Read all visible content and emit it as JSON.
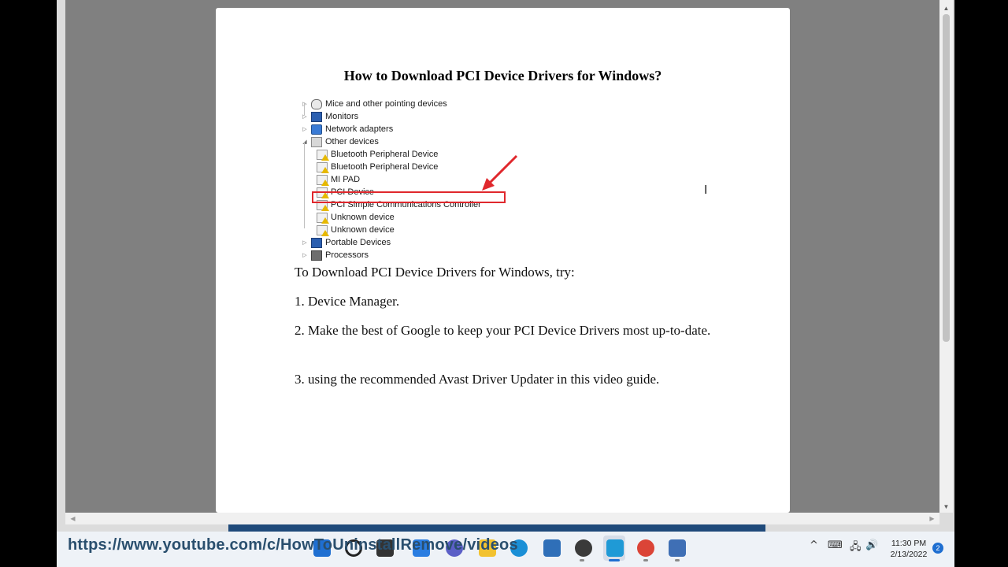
{
  "document": {
    "title": "How to Download PCI Device Drivers for Windows?",
    "device_tree": [
      {
        "label": "Mice and other pointing devices",
        "icon": "mouse-icon",
        "expander": "▷"
      },
      {
        "label": "Monitors",
        "icon": "monitor-icon",
        "expander": "▷"
      },
      {
        "label": "Network adapters",
        "icon": "network-adapter-icon",
        "expander": "▷"
      },
      {
        "label": "Other devices",
        "icon": "other-devices-icon",
        "expander": "◢"
      },
      {
        "label": "Bluetooth Peripheral Device",
        "icon": "warning-device-icon"
      },
      {
        "label": "Bluetooth Peripheral Device",
        "icon": "warning-device-icon"
      },
      {
        "label": "MI PAD",
        "icon": "warning-device-icon"
      },
      {
        "label": "PCI Device",
        "icon": "warning-device-icon"
      },
      {
        "label": "PCI Simple Communications Controller",
        "icon": "warning-device-icon",
        "highlighted": true
      },
      {
        "label": "Unknown device",
        "icon": "warning-device-icon"
      },
      {
        "label": "Unknown device",
        "icon": "warning-device-icon"
      },
      {
        "label": "Portable Devices",
        "icon": "portable-devices-icon",
        "expander": "▷"
      },
      {
        "label": "Processors",
        "icon": "processor-icon",
        "expander": "▷"
      }
    ],
    "paragraphs": [
      "To Download PCI Device Drivers for Windows, try:",
      "1. Device Manager.",
      "2. Make the best of Google to keep your PCI Device Drivers most up-to-date.",
      "3. using the recommended Avast Driver Updater in this video guide."
    ],
    "highlight_color": "#e0282d"
  },
  "scrollbars": {
    "up_arrow": "▲",
    "down_arrow": "▼",
    "left_arrow": "◀",
    "right_arrow": "▶"
  },
  "overlay": {
    "url": "https://www.youtube.com/c/HowToUninstallRemove/videos"
  },
  "taskbar": {
    "apps": [
      {
        "name": "start-icon",
        "color": "#1f6fd1"
      },
      {
        "name": "search-icon",
        "color": "#222222"
      },
      {
        "name": "task-view-icon",
        "color": "#333333"
      },
      {
        "name": "widgets-icon",
        "color": "#2a7de1"
      },
      {
        "name": "chat-icon",
        "color": "#5b5fc7"
      },
      {
        "name": "file-explorer-icon",
        "color": "#f2c230"
      },
      {
        "name": "edge-icon",
        "color": "#1a8fd6"
      },
      {
        "name": "store-icon",
        "color": "#2f6fb8"
      },
      {
        "name": "media-player-icon",
        "color": "#3a3a3a"
      },
      {
        "name": "reader-app-icon",
        "color": "#1f9ad6"
      },
      {
        "name": "chrome-icon",
        "color": "#db4437"
      },
      {
        "name": "device-manager-icon",
        "color": "#3f6fb5"
      }
    ],
    "tray": {
      "chevron": "^",
      "keyboard": "⌨",
      "network": "🖧",
      "volume": "🔊",
      "time": "11:30 PM",
      "date": "2/13/2022",
      "notifications": "2"
    }
  }
}
